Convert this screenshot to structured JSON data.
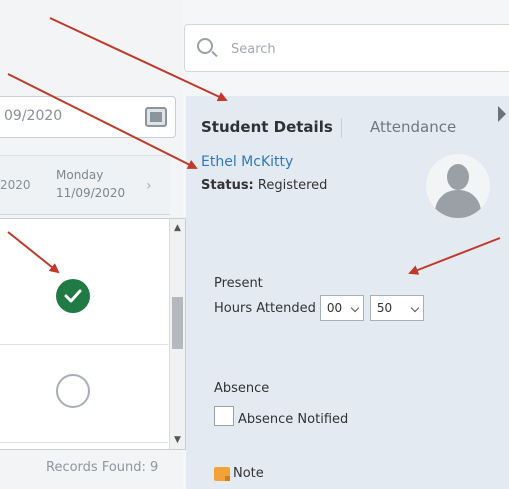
{
  "search": {
    "placeholder": "Search"
  },
  "date_picker": {
    "value": "09/2020"
  },
  "schedule": {
    "prev_day_date": "2020",
    "current_day_name": "Monday",
    "current_day_date": "11/09/2020"
  },
  "records": {
    "text": "Records Found: 9"
  },
  "tabs": {
    "active": "Student Details",
    "inactive": "Attendance"
  },
  "student": {
    "name": "Ethel McKitty",
    "status_label": "Status:",
    "status_value": "Registered"
  },
  "present": {
    "label": "Present",
    "hours_label": "Hours Attended",
    "hours_value": "00",
    "minutes_value": "50"
  },
  "absence": {
    "label": "Absence",
    "checkbox_label": "Absence Notified"
  },
  "note": {
    "label": "Note"
  },
  "colors": {
    "accent": "#2f79b7",
    "present_check": "#1f7a44",
    "annotation": "#c0392b"
  }
}
